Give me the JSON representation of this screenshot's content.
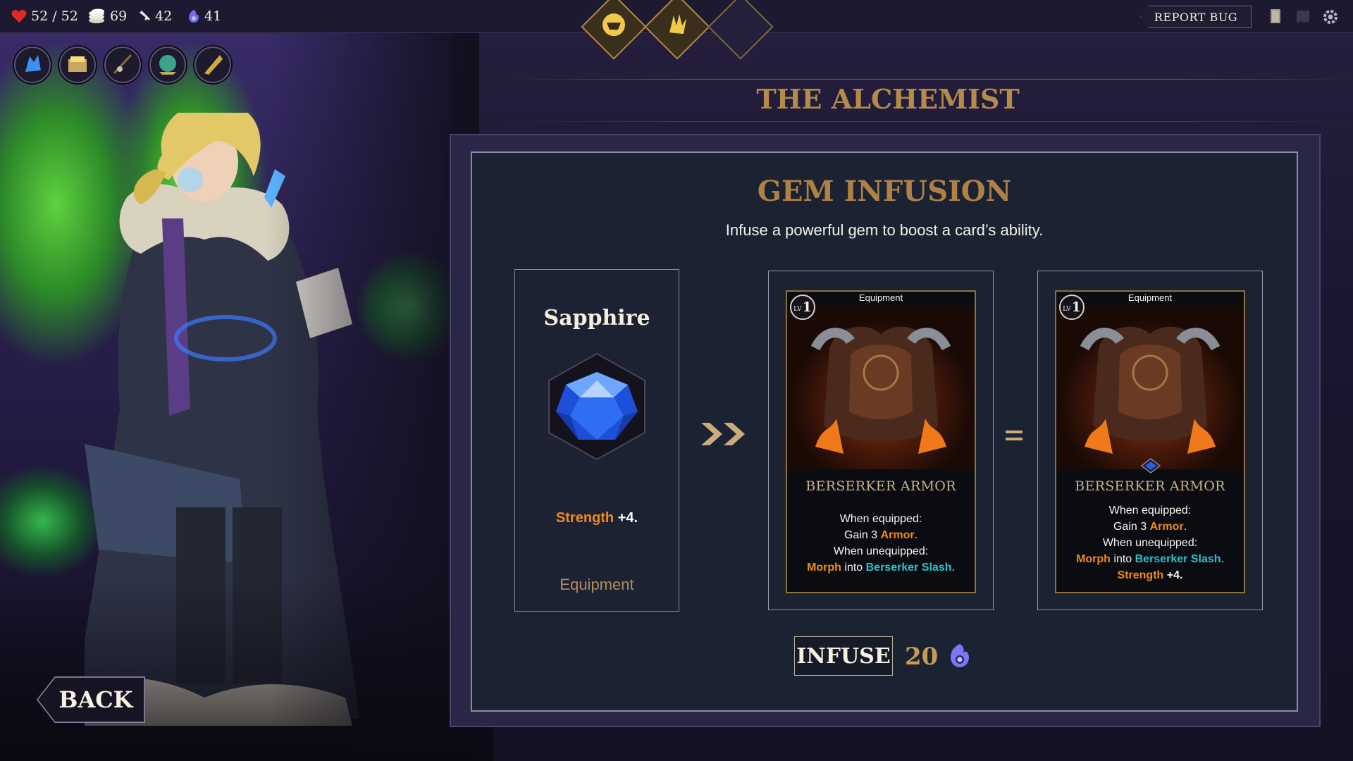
{
  "top_bar": {
    "health": "52 / 52",
    "gold": "69",
    "keys": "42",
    "souls": "41",
    "report_bug_label": "REPORT BUG",
    "icons": [
      "deck-icon",
      "map-icon",
      "settings-gear-icon"
    ]
  },
  "relics": [
    "blue-crystal-relic",
    "treasure-tome-relic",
    "fishing-rod-relic",
    "green-orb-relic",
    "golden-horn-relic"
  ],
  "emblems": [
    "beast-maw-emblem",
    "golden-claw-emblem",
    "empty-emblem-slot"
  ],
  "page_title": "THE ALCHEMIST",
  "panel": {
    "title": "GEM INFUSION",
    "subtitle": "Infuse a powerful gem to boost a card’s ability."
  },
  "gem": {
    "name": "Sapphire",
    "effect_keyword": "Strength",
    "effect_value": " +4.",
    "type": "Equipment",
    "color": "#2a6ef0"
  },
  "card_before": {
    "type": "Equipment",
    "level_prefix": "LV",
    "level": "1",
    "name": "BERSERKER ARMOR",
    "line1": "When equipped:",
    "line2_pre": "Gain 3 ",
    "line2_kw": "Armor",
    "line2_post": ".",
    "line3": "When unequipped:",
    "line4_kw1": "Morph",
    "line4_mid": " into ",
    "line4_kw2": "Berserker Slash",
    "line4_post": "."
  },
  "card_after": {
    "type": "Equipment",
    "level_prefix": "LV",
    "level": "1",
    "name": "BERSERKER ARMOR",
    "line1": "When equipped:",
    "line2_pre": "Gain 3 ",
    "line2_kw": "Armor",
    "line2_post": ".",
    "line3": "When unequipped:",
    "line4_kw1": "Morph",
    "line4_mid": " into ",
    "line4_kw2": "Berserker Slash",
    "line4_post": ".",
    "line5_kw": "Strength",
    "line5_post": " +4."
  },
  "infuse": {
    "button_label": "INFUSE",
    "cost": "20"
  },
  "back_label": "BACK",
  "colors": {
    "keyword_orange": "#f08a1c",
    "keyword_teal": "#2cc1c9",
    "title_gold": "#b58a4a"
  }
}
